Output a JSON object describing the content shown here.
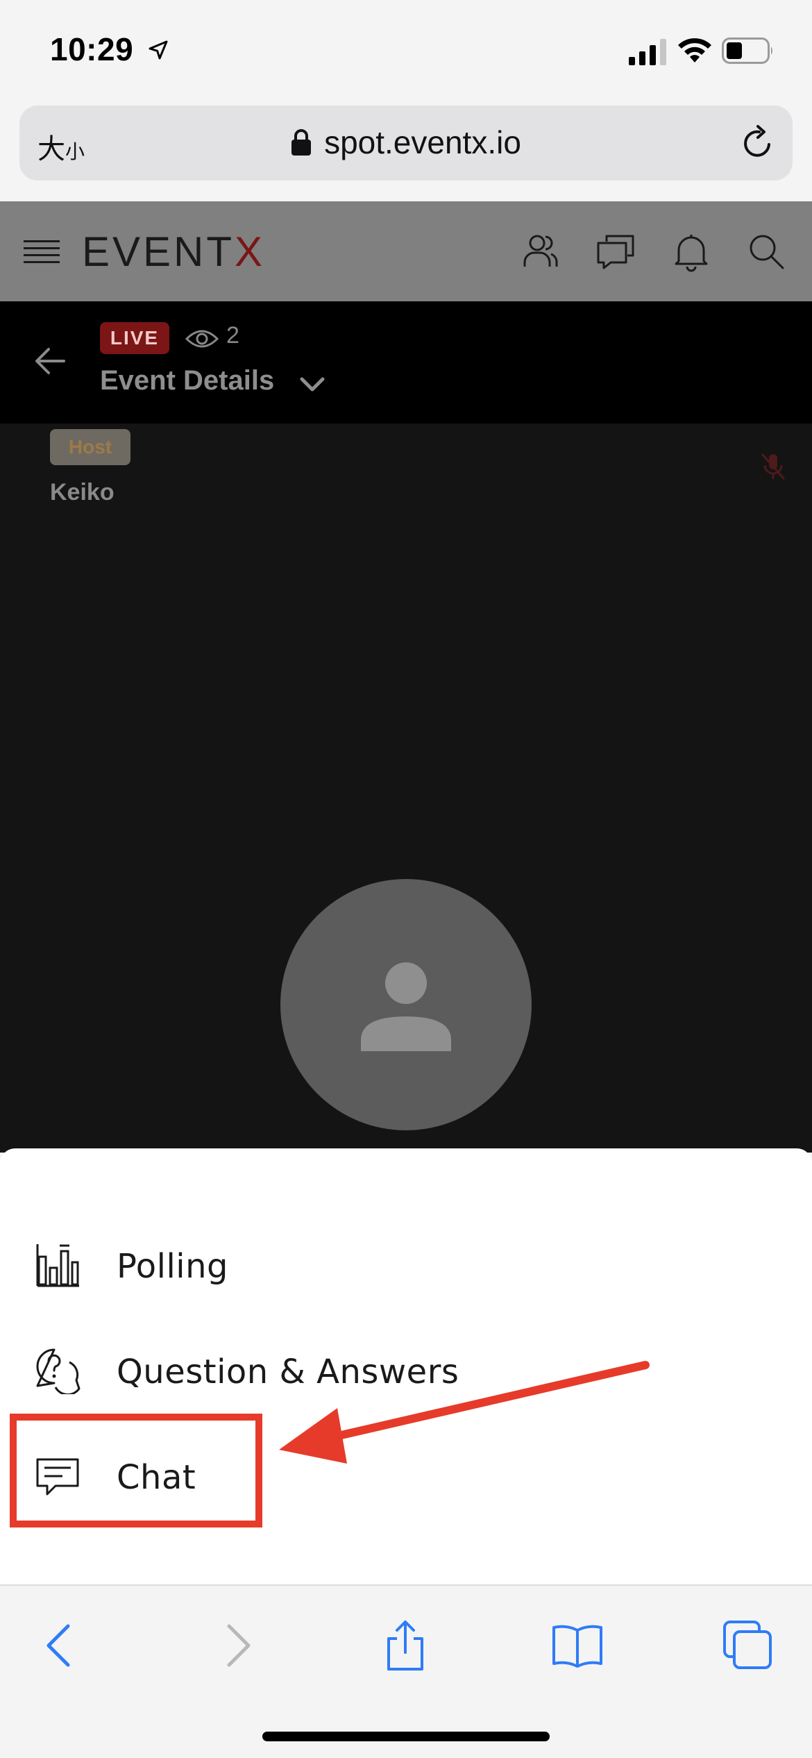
{
  "status_bar": {
    "time": "10:29"
  },
  "address_bar": {
    "text_size_big": "大",
    "text_size_small": "小",
    "url": "spot.eventx.io"
  },
  "app_header": {
    "logo_main": "EVENT",
    "logo_accent": "X"
  },
  "session": {
    "live_label": "LIVE",
    "viewer_count": "2",
    "title": "Event Details"
  },
  "stage": {
    "host_badge": "Host",
    "host_name": "Keiko"
  },
  "sheet": {
    "items": [
      {
        "label": "Polling",
        "icon": "bar-chart-icon"
      },
      {
        "label": "Question & Answers",
        "icon": "qa-bubbles-icon"
      },
      {
        "label": "Chat",
        "icon": "chat-icon"
      }
    ]
  },
  "colors": {
    "annotation": "#e63b2a",
    "live": "#7c1515",
    "ios_blue": "#2f7cf6"
  }
}
